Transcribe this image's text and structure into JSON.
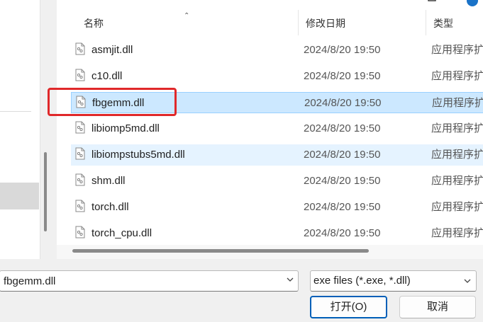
{
  "columns": {
    "name": "名称",
    "date": "修改日期",
    "type": "类型"
  },
  "files": [
    {
      "name": "asmjit.dll",
      "date": "2024/8/20 19:50",
      "type": "应用程序扩"
    },
    {
      "name": "c10.dll",
      "date": "2024/8/20 19:50",
      "type": "应用程序扩"
    },
    {
      "name": "fbgemm.dll",
      "date": "2024/8/20 19:50",
      "type": "应用程序扩",
      "state": "selected"
    },
    {
      "name": "libiomp5md.dll",
      "date": "2024/8/20 19:50",
      "type": "应用程序扩"
    },
    {
      "name": "libiompstubs5md.dll",
      "date": "2024/8/20 19:50",
      "type": "应用程序扩",
      "state": "hover"
    },
    {
      "name": "shm.dll",
      "date": "2024/8/20 19:50",
      "type": "应用程序扩"
    },
    {
      "name": "torch.dll",
      "date": "2024/8/20 19:50",
      "type": "应用程序扩"
    },
    {
      "name": "torch_cpu.dll",
      "date": "2024/8/20 19:50",
      "type": "应用程序扩"
    }
  ],
  "file_name_input": {
    "value": "fbgemm.dll"
  },
  "file_type_filter": {
    "selected": "exe files (*.exe, *.dll)"
  },
  "buttons": {
    "open": "打开(O)",
    "cancel": "取消"
  },
  "colors": {
    "selected_row": "#cce8ff",
    "hover_row": "#e5f3ff",
    "highlight_annotation": "#e0282a",
    "primary_button_border": "#005fb8"
  },
  "icons": [
    "file-dll-icon",
    "chevron-down-icon",
    "sort-up-icon",
    "maximize-icon",
    "help-icon"
  ]
}
